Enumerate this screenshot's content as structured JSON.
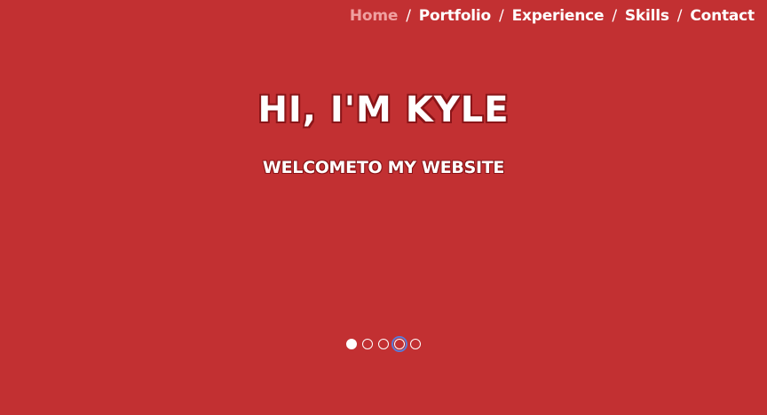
{
  "nav": {
    "items": [
      {
        "label": "Home",
        "active": true
      },
      {
        "label": "Portfolio",
        "active": false
      },
      {
        "label": "Experience",
        "active": false
      },
      {
        "label": "Skills",
        "active": false
      },
      {
        "label": "Contact",
        "active": false
      }
    ],
    "separator": "/"
  },
  "hero": {
    "title": "HI, I'M KYLE",
    "subtitle": "WELCOMETO MY WEBSITE"
  },
  "slider": {
    "count": 5,
    "active_index": 0,
    "focused_index": 3
  },
  "colors": {
    "background": "#c23032",
    "text": "#ffffff",
    "active_nav": "#f0a0a0"
  }
}
